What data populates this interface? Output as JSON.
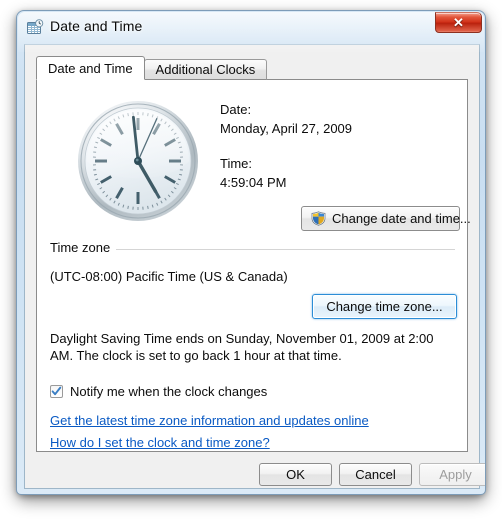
{
  "window": {
    "title": "Date and Time",
    "icon": "date-time-icon",
    "close_glyph": "✕"
  },
  "tabs": [
    {
      "label": "Date and Time",
      "active": true
    },
    {
      "label": "Additional Clocks",
      "active": false
    }
  ],
  "main": {
    "date_label": "Date:",
    "date_value": "Monday, April 27, 2009",
    "time_label": "Time:",
    "time_value": "4:59:04 PM",
    "change_date_time_button": "Change date and time...",
    "clock": {
      "hour": 4,
      "minute": 59,
      "second": 4,
      "face_color": "#eef3f7",
      "bezel_color": "#b9c3c9",
      "hand_color": "#3f5b66"
    }
  },
  "time_zone": {
    "group_label": "Time zone",
    "value": "(UTC-08:00) Pacific Time (US & Canada)",
    "change_button": "Change time zone..."
  },
  "daylight_saving": {
    "text": "Daylight Saving Time ends on Sunday, November 01, 2009 at 2:00 AM. The clock is set to go back 1 hour at that time."
  },
  "notify": {
    "label": "Notify me when the clock changes",
    "checked": true
  },
  "links": [
    {
      "label": "Get the latest time zone information and updates online"
    },
    {
      "label": "How do I set the clock and time zone?"
    }
  ],
  "footer": {
    "ok": "OK",
    "cancel": "Cancel",
    "apply": "Apply",
    "apply_enabled": false
  },
  "colors": {
    "link": "#0a5ac4",
    "title_bar": "#cfe2f3",
    "close_button": "#cf2f17",
    "focus_border": "#2c8dd6"
  }
}
